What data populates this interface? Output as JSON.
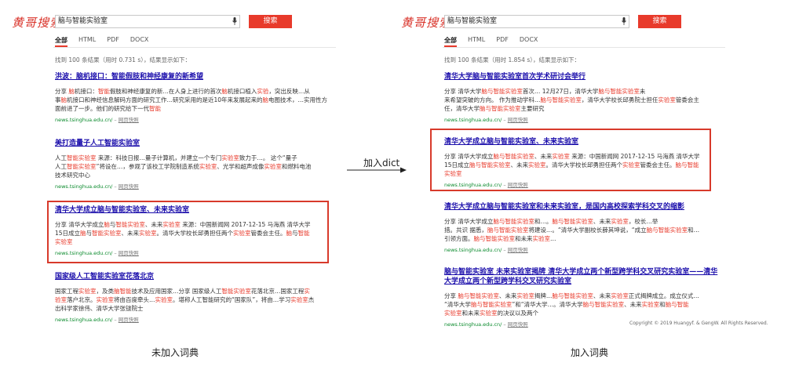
{
  "logo_text": "黄哥搜索",
  "search_label": "搜索",
  "tabs": [
    "全部",
    "HTML",
    "PDF",
    "DOCX"
  ],
  "left": {
    "query": "脑与智能实验室",
    "stats": "找到 100 条结果（用时 0.731 s），结果显示如下：",
    "results": [
      {
        "title": "洪波：脑机接口：智能假肢和神经康复的新希望",
        "snippet": [
          [
            [
              "分享 ",
              0
            ],
            [
              "脑",
              1
            ],
            [
              "机接口：",
              0
            ],
            [
              "智能",
              1
            ],
            [
              "假肢和神经康复的新…在人身上进行的首次",
              0
            ],
            [
              "脑",
              1
            ],
            [
              "机接口植入",
              0
            ],
            [
              "实验",
              1
            ],
            [
              "，突出反映…从",
              0
            ]
          ],
          [
            [
              "事",
              0
            ],
            [
              "脑",
              1
            ],
            [
              "机接口和神经信息解码方面的研究工作…研究采用的是近10年来发展起来的",
              0
            ],
            [
              "脑",
              1
            ],
            [
              "电图技术，…实用性方",
              0
            ]
          ],
          [
            [
              "面前进了一步。他们的研究给下一代",
              0
            ],
            [
              "智能",
              1
            ]
          ]
        ],
        "url": "news.tsinghua.edu.cn/",
        "cache": "网页快照"
      },
      {
        "title": "美打造量子人工智能实验室",
        "snippet": [
          [
            [
              "人工",
              0
            ],
            [
              "智能",
              1
            ],
            [
              "实验室",
              1
            ],
            [
              " 来源：科技日报…量子计算机，并建立一个专门",
              0
            ],
            [
              "实验室",
              1
            ],
            [
              "致力于…。       这个“量子",
              0
            ]
          ],
          [
            [
              "人工",
              0
            ],
            [
              "智能",
              1
            ],
            [
              "实验室",
              1
            ],
            [
              "”将设在…，参观了该校工学院制造系统",
              0
            ],
            [
              "实验室",
              1
            ],
            [
              "、光学和超声成像",
              0
            ],
            [
              "实验室",
              1
            ],
            [
              "和燃料电池",
              0
            ]
          ],
          [
            [
              "技术研究中心",
              0
            ]
          ]
        ],
        "url": "news.tsinghua.edu.cn/",
        "cache": "网页快照"
      },
      {
        "title": "清华大学成立脑与智能实验室、未来实验室",
        "snippet": [
          [
            [
              "分享 清华大学成立",
              0
            ],
            [
              "脑",
              1
            ],
            [
              "与",
              0
            ],
            [
              "智能",
              1
            ],
            [
              "实验室",
              1
            ],
            [
              "、未来",
              0
            ],
            [
              "实验室",
              1
            ],
            [
              " 来源：中国新闻网 2017-12-15 马海燕 清华大学",
              0
            ]
          ],
          [
            [
              "15日成立",
              0
            ],
            [
              "脑",
              1
            ],
            [
              "与",
              0
            ],
            [
              "智能",
              1
            ],
            [
              "实验室",
              1
            ],
            [
              "、未来",
              0
            ],
            [
              "实验室",
              1
            ],
            [
              "。清华大学校长邱勇担任两个",
              0
            ],
            [
              "实验室",
              1
            ],
            [
              "管委会主任。",
              0
            ],
            [
              "脑",
              1
            ],
            [
              "与",
              0
            ],
            [
              "智能",
              1
            ]
          ],
          [
            [
              "实验室",
              1
            ]
          ]
        ],
        "url": "news.tsinghua.edu.cn/",
        "cache": "网页快照"
      },
      {
        "title": "国家级人工智能实验室花落北京",
        "snippet": [
          [
            [
              "国家工程",
              0
            ],
            [
              "实验室",
              1
            ],
            [
              "，及类",
              0
            ],
            [
              "脑智能",
              1
            ],
            [
              "技术及应用国家…分享 国家级人工",
              0
            ],
            [
              "智能",
              1
            ],
            [
              "实验室",
              1
            ],
            [
              "花落北京…国家工程",
              0
            ],
            [
              "实",
              1
            ]
          ],
          [
            [
              "验室",
              1
            ],
            [
              "落户北京。",
              0
            ],
            [
              "实验室",
              1
            ],
            [
              "将由百度牵头…",
              0
            ],
            [
              "实验室",
              1
            ],
            [
              "。堪称人工智能研究的“国家队”，将由…学习",
              0
            ],
            [
              "实验室",
              1
            ],
            [
              "杰",
              0
            ]
          ],
          [
            [
              "出科学家徐伟、清华大学张钹院士",
              0
            ]
          ]
        ],
        "url": "news.tsinghua.edu.cn/",
        "cache": "网页快照"
      }
    ]
  },
  "right": {
    "query": "脑与智能实验室",
    "stats": "找到 100 条结果（用时 1.854 s），结果显示如下：",
    "results": [
      {
        "title": "清华大学脑与智能实验室首次学术研讨会举行",
        "snippet": [
          [
            [
              "分享 清华大学",
              0
            ],
            [
              "脑与智能实验室",
              1
            ],
            [
              "首次… 12月27日，清华大学",
              0
            ],
            [
              "脑与智能实验室",
              1
            ],
            [
              "未",
              0
            ]
          ],
          [
            [
              "来希望突破的方向。 作为推动学科…",
              0
            ],
            [
              "脑与智能实验室",
              1
            ],
            [
              "，清华大学校长邱勇院士担任",
              0
            ],
            [
              "实验室",
              1
            ],
            [
              "管委会主",
              0
            ]
          ],
          [
            [
              "任，清华大学",
              0
            ],
            [
              "脑与智能实验室",
              1
            ],
            [
              "主要研究",
              0
            ]
          ]
        ],
        "url": "news.tsinghua.edu.cn/",
        "cache": "网页快照"
      },
      {
        "title": "清华大学成立脑与智能实验室、未来实验室",
        "snippet": [
          [
            [
              "分享 清华大学成立",
              0
            ],
            [
              "脑与智能实验室",
              1
            ],
            [
              "、未来",
              0
            ],
            [
              "实验室",
              1
            ],
            [
              " 来源：中国新闻网 2017-12-15 马海燕 清华大学",
              0
            ]
          ],
          [
            [
              "15日成立",
              0
            ],
            [
              "脑与智能实验室",
              1
            ],
            [
              "、未来",
              0
            ],
            [
              "实验室",
              1
            ],
            [
              "。清华大学校长邱勇担任两个",
              0
            ],
            [
              "实验室",
              1
            ],
            [
              "管委会主任。",
              0
            ],
            [
              "脑与智能",
              1
            ]
          ],
          [
            [
              "实验室",
              1
            ]
          ]
        ],
        "url": "news.tsinghua.edu.cn/",
        "cache": "网页快照"
      },
      {
        "title": "清华大学成立脑与智能实验室和未来实验室，是国内高校探索学科交叉的缩影",
        "snippet": [
          [
            [
              "分享 清华大学成立",
              0
            ],
            [
              "脑与智能实验室",
              1
            ],
            [
              "和…。",
              0
            ],
            [
              "脑与智能实验室",
              1
            ],
            [
              "、未来",
              0
            ],
            [
              "实验室",
              1
            ],
            [
              "，校长…举",
              0
            ]
          ],
          [
            [
              "措。共识 据悉，",
              0
            ],
            [
              "脑与智能实验室",
              1
            ],
            [
              "将建设…。“清华大学副校长薛其坤说，“成立",
              0
            ],
            [
              "脑与智能实验室",
              1
            ],
            [
              "和…",
              0
            ]
          ],
          [
            [
              "引领方面。",
              0
            ],
            [
              "脑与智能实验室",
              1
            ],
            [
              "和未来",
              0
            ],
            [
              "实验室",
              1
            ],
            [
              "…",
              0
            ]
          ]
        ],
        "url": "news.tsinghua.edu.cn/",
        "cache": "网页快照"
      },
      {
        "title": "脑与智能实验室 未来实验室揭牌 清华大学成立两个新型跨学科交叉研究实验室——清华大学成立两个新型跨学科交叉研究实验室",
        "snippet": [
          [
            [
              "分享 ",
              0
            ],
            [
              "脑与智能实验室",
              1
            ],
            [
              "、未来",
              0
            ],
            [
              "实验室",
              1
            ],
            [
              "揭牌…",
              0
            ],
            [
              "脑与智能实验室",
              1
            ],
            [
              "、未来",
              0
            ],
            [
              "实验室",
              1
            ],
            [
              "正式揭牌成立。成立仪式…",
              0
            ]
          ],
          [
            [
              "“清华大学",
              0
            ],
            [
              "脑与智能实验室",
              1
            ],
            [
              "”和“清华大学…。清华大学",
              0
            ],
            [
              "脑与智能实验室",
              1
            ],
            [
              "、未来",
              0
            ],
            [
              "实验室",
              1
            ],
            [
              "和",
              0
            ],
            [
              "脑与智能",
              1
            ]
          ],
          [
            [
              "实验室",
              1
            ],
            [
              "和未来",
              0
            ],
            [
              "实验室",
              1
            ],
            [
              "的决议以及两个",
              0
            ]
          ]
        ],
        "url": "news.tsinghua.edu.cn/",
        "cache": "网页快照"
      }
    ],
    "copyright": "Copyright © 2019 Huangyf. & GengW. All Rights Reserved."
  },
  "arrow_label": "加入dict",
  "caption_left": "未加入词典",
  "caption_right": "加入词典",
  "colors": {
    "accent": "#e83a2b",
    "link": "#1a0dab",
    "url": "#0a8a2c",
    "box": "#d83a2b"
  }
}
